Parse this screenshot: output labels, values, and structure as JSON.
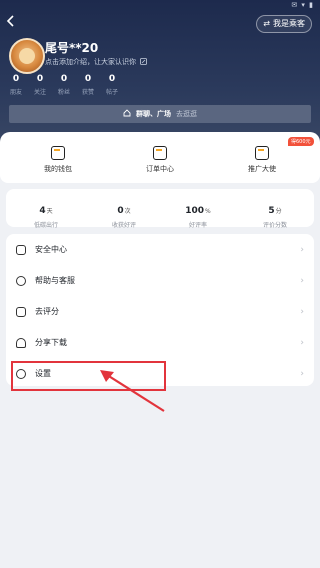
{
  "header": {
    "status_text": "✉ ▾ ▮",
    "back_icon": "back-arrow-icon",
    "switch_label": "我是乘客",
    "switch_icon": "switch-arrows-icon",
    "username": "尾号**20",
    "intro": "点击添加介绍，让大家认识你",
    "intro_icon": "edit-icon",
    "stats": [
      {
        "value": "0",
        "label": "朋友"
      },
      {
        "value": "0",
        "label": "关注"
      },
      {
        "value": "0",
        "label": "粉丝"
      },
      {
        "value": "0",
        "label": "获赞"
      },
      {
        "value": "0",
        "label": "帖子"
      }
    ],
    "group": {
      "title": "群聊、广场",
      "sub": "去逛逛",
      "icon": "plaza-icon"
    }
  },
  "quick_actions": [
    {
      "label": "我的钱包",
      "icon": "wallet-icon"
    },
    {
      "label": "订单中心",
      "icon": "order-icon"
    },
    {
      "label": "推广大使",
      "icon": "promote-icon",
      "badge": "得600元"
    }
  ],
  "driver_stats": [
    {
      "value": "4",
      "unit": "天",
      "label": "低碳出行"
    },
    {
      "value": "0",
      "unit": "次",
      "label": "收获好评"
    },
    {
      "value": "100",
      "unit": "%",
      "label": "好评率"
    },
    {
      "value": "5",
      "unit": "分",
      "label": "评价分数"
    }
  ],
  "menu": [
    {
      "label": "安全中心",
      "icon": "shield-icon"
    },
    {
      "label": "帮助与客服",
      "icon": "help-icon"
    },
    {
      "label": "去评分",
      "icon": "thumb-up-icon"
    },
    {
      "label": "分享下载",
      "icon": "share-icon"
    },
    {
      "label": "设置",
      "icon": "gear-icon"
    }
  ],
  "chevron": "›",
  "annotation_color": "#e2343c"
}
